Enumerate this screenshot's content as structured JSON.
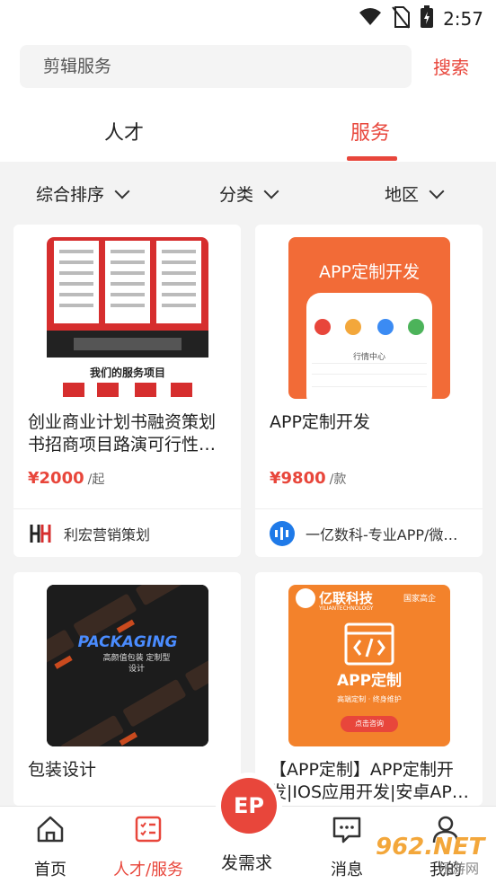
{
  "status_bar": {
    "time": "2:57"
  },
  "search": {
    "placeholder": "剪辑服务",
    "button_label": "搜索"
  },
  "tabs": [
    {
      "label": "人才",
      "active": false
    },
    {
      "label": "服务",
      "active": true
    }
  ],
  "filters": {
    "sort": "综合排序",
    "category": "分类",
    "region": "地区"
  },
  "cards": [
    {
      "title": "创业商业计划书融资策划书招商项目路演可行性…",
      "price": "¥2000",
      "price_unit": "/起",
      "seller": "利宏营销策划",
      "thumb_text": "我们的服务项目"
    },
    {
      "title": "APP定制开发",
      "price": "¥9800",
      "price_unit": "/款",
      "seller": "一亿数科-专业APP/微…",
      "thumb_text": "APP定制开发",
      "thumb_subtext": "行情中心"
    },
    {
      "title": "包装设计",
      "thumb_text": "PACKAGING",
      "thumb_subtext": "高颜值包装 定制型设计"
    },
    {
      "title": "【APP定制】APP定制开发|IOS应用开发|安卓AP…",
      "thumb_brand": "亿联科技",
      "thumb_brand_tag": "国家高企",
      "thumb_brand_en": "YILIANTECHNOLOGY",
      "thumb_text": "APP定制",
      "thumb_subtext": "高端定制 · 终身维护",
      "thumb_cta": "点击咨询"
    }
  ],
  "bottom_nav": {
    "home": "首页",
    "service": "人才/服务",
    "post": "发需求",
    "post_icon": "EP",
    "messages": "消息",
    "me": "我的"
  },
  "watermark": {
    "text": "962.NET",
    "sub": "乐游网"
  },
  "colors": {
    "accent": "#e8463b",
    "background": "#f3f3f3"
  }
}
